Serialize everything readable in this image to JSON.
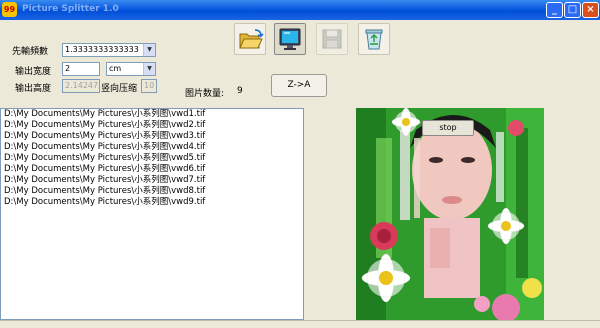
{
  "window": {
    "icon_text": "99",
    "title": "Picture Splitter 1.0",
    "buttons": [
      "_",
      "□",
      "×"
    ]
  },
  "form": {
    "output_frames": {
      "label": "先輸頻數",
      "value": "1.3333333333333"
    },
    "output_width": {
      "label": "输出宽度",
      "value": "2",
      "unit": "cm"
    },
    "output_height": {
      "label": "输出高度",
      "value": "2.14247",
      "compress_label": "竖向压缩",
      "compress_value": "10"
    }
  },
  "image_count": {
    "label": "图片数量:",
    "value": "9"
  },
  "toolbar": {
    "open_icon": "folder-open-icon",
    "display_icon": "monitor-icon",
    "save_icon": "floppy-disk-icon",
    "recycle_icon": "recycle-bin-icon"
  },
  "sort_button": "Z->A",
  "stop_button": "stop",
  "files": [
    "D:\\My Documents\\My Pictures\\小系列图\\vwd1.tif",
    "D:\\My Documents\\My Pictures\\小系列图\\vwd2.tif",
    "D:\\My Documents\\My Pictures\\小系列图\\vwd3.tif",
    "D:\\My Documents\\My Pictures\\小系列图\\vwd4.tif",
    "D:\\My Documents\\My Pictures\\小系列图\\vwd5.tif",
    "D:\\My Documents\\My Pictures\\小系列图\\vwd6.tif",
    "D:\\My Documents\\My Pictures\\小系列图\\vwd7.tif",
    "D:\\My Documents\\My Pictures\\小系列图\\vwd8.tif",
    "D:\\My Documents\\My Pictures\\小系列图\\vwd9.tif"
  ]
}
